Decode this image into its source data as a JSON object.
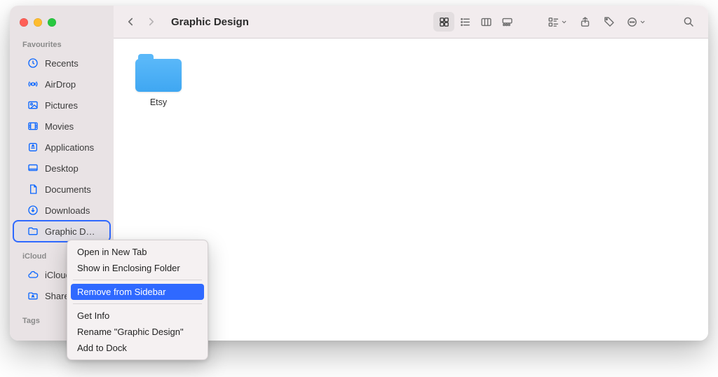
{
  "window": {
    "title": "Graphic Design"
  },
  "sidebar": {
    "sections": {
      "favourites": {
        "title": "Favourites",
        "items": [
          {
            "icon": "clock-icon",
            "label": "Recents"
          },
          {
            "icon": "airdrop-icon",
            "label": "AirDrop"
          },
          {
            "icon": "pictures-icon",
            "label": "Pictures"
          },
          {
            "icon": "movies-icon",
            "label": "Movies"
          },
          {
            "icon": "applications-icon",
            "label": "Applications"
          },
          {
            "icon": "desktop-icon",
            "label": "Desktop"
          },
          {
            "icon": "documents-icon",
            "label": "Documents"
          },
          {
            "icon": "downloads-icon",
            "label": "Downloads"
          },
          {
            "icon": "folder-icon",
            "label": "Graphic D…",
            "selected": true
          }
        ]
      },
      "icloud": {
        "title": "iCloud",
        "items": [
          {
            "icon": "icloud-icon",
            "label": "iCloud"
          },
          {
            "icon": "shared-icon",
            "label": "Shared"
          }
        ]
      },
      "tags": {
        "title": "Tags"
      }
    }
  },
  "contextMenu": {
    "groups": [
      [
        "Open in New Tab",
        "Show in Enclosing Folder"
      ],
      [
        "Remove from Sidebar"
      ],
      [
        "Get Info",
        "Rename \"Graphic Design\"",
        "Add to Dock"
      ]
    ],
    "highlighted": "Remove from Sidebar"
  },
  "content": {
    "items": [
      {
        "type": "folder",
        "label": "Etsy"
      }
    ]
  }
}
